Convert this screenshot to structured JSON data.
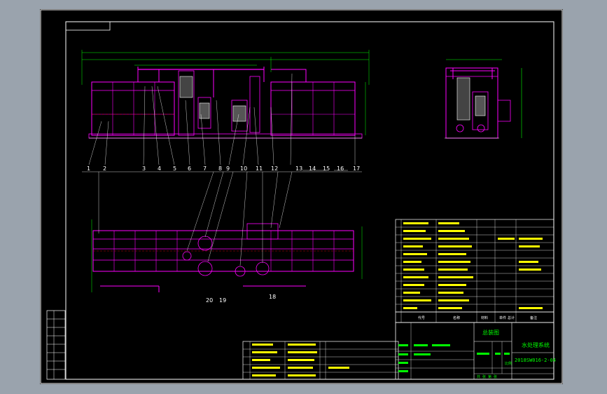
{
  "title_block": {
    "drawing_name": "水处理系统",
    "drawing_code": "2018SW016-2-04",
    "product_name": "总装图",
    "header_code": "代号",
    "header_name": "名称",
    "header_material": "材料",
    "header_qty": "单件",
    "header_total": "总计",
    "header_remark": "备注",
    "scale_label": "比例",
    "sheet_label": "共  张  第  张"
  },
  "balloons_top": [
    "1",
    "2",
    "3",
    "4",
    "5",
    "6",
    "7",
    "8",
    "9",
    "10",
    "11",
    "12",
    "13",
    "14",
    "15",
    "16",
    "17"
  ],
  "balloons_plan": [
    "20",
    "19",
    "18"
  ],
  "colors": {
    "sheet": "#000000",
    "outline": "#ffffff",
    "equipment": "#ff00ff",
    "dimension": "#00ff00",
    "text": "#ffff00",
    "hidden": "#ff0000",
    "pipe": "#00ffff"
  }
}
